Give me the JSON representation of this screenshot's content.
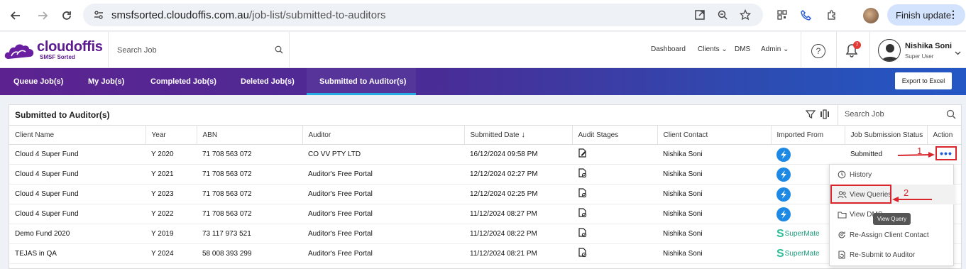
{
  "browser": {
    "url_host": "smsfsorted.cloudoffis.com.au",
    "url_path": "/job-list/submitted-to-auditors",
    "finish_update_label": "Finish update"
  },
  "app": {
    "logo_text": "cloudoffis",
    "logo_sub": "SMSF Sorted",
    "search_placeholder": "Search Job",
    "nav": {
      "dashboard": "Dashboard",
      "clients": "Clients",
      "dms": "DMS",
      "admin": "Admin"
    },
    "notification_count": "7",
    "user": {
      "name": "Nishika Soni",
      "role": "Super User"
    }
  },
  "tabs": [
    {
      "label": "Queue Job(s)"
    },
    {
      "label": "My Job(s)"
    },
    {
      "label": "Completed Job(s)"
    },
    {
      "label": "Deleted Job(s)"
    },
    {
      "label": "Submitted to Auditor(s)"
    }
  ],
  "active_tab": "Submitted to Auditor(s)",
  "export_label": "Export to Excel",
  "panel": {
    "title": "Submitted to Auditor(s)",
    "search_placeholder": "Search Job"
  },
  "table": {
    "columns": [
      "Client Name",
      "Year",
      "ABN",
      "Auditor",
      "Submitted Date",
      "Audit Stages",
      "Client Contact",
      "Imported From",
      "Job Submission Status",
      "Action"
    ],
    "rows": [
      {
        "client": "Cloud 4 Super Fund",
        "year": "Y 2020",
        "abn": "71 708 563 072",
        "auditor": "CO VV PTY LTD",
        "date": "16/12/2024 09:58 PM",
        "contact": "Nishika Soni",
        "imported": "round",
        "status": "Submitted"
      },
      {
        "client": "Cloud 4 Super Fund",
        "year": "Y 2021",
        "abn": "71 708 563 072",
        "auditor": "Auditor's Free Portal",
        "date": "12/12/2024 02:27 PM",
        "contact": "Nishika Soni",
        "imported": "round",
        "status": ""
      },
      {
        "client": "Cloud 4 Super Fund",
        "year": "Y 2023",
        "abn": "71 708 563 072",
        "auditor": "Auditor's Free Portal",
        "date": "12/12/2024 02:25 PM",
        "contact": "Nishika Soni",
        "imported": "round",
        "status": ""
      },
      {
        "client": "Cloud 4 Super Fund",
        "year": "Y 2022",
        "abn": "71 708 563 072",
        "auditor": "Auditor's Free Portal",
        "date": "11/12/2024 08:27 PM",
        "contact": "Nishika Soni",
        "imported": "round",
        "status": ""
      },
      {
        "client": "Demo Fund 2020",
        "year": "Y 2019",
        "abn": "73 117 973 521",
        "auditor": "Auditor's Free Portal",
        "date": "11/12/2024 08:22 PM",
        "contact": "Nishika Soni",
        "imported": "SuperMate",
        "status": ""
      },
      {
        "client": "TEJAS in QA",
        "year": "Y 2024",
        "abn": "58 008 393 299",
        "auditor": "Auditor's Free Portal",
        "date": "11/12/2024 08:21 PM",
        "contact": "Nishika Soni",
        "imported": "SuperMate",
        "status": ""
      }
    ]
  },
  "action_menu": {
    "items": [
      {
        "label": "History",
        "icon": "history-icon"
      },
      {
        "label": "View Queries",
        "icon": "users-icon"
      },
      {
        "label": "View DMS",
        "icon": "folder-icon"
      },
      {
        "label": "Re-Assign Client Contact",
        "icon": "reassign-icon"
      },
      {
        "label": "Re-Submit to Auditor",
        "icon": "resubmit-icon"
      }
    ],
    "tooltip": "View Query"
  },
  "annotations": {
    "step1": "1",
    "step2": "2"
  },
  "colors": {
    "annotation": "#d9262c",
    "brand_purple": "#5b1a8f",
    "action_blue": "#1e5ad6"
  }
}
